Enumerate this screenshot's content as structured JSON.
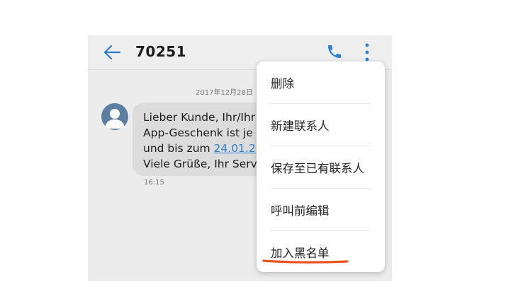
{
  "header": {
    "title": "70251",
    "back_icon": "arrow-left-icon",
    "call_icon": "phone-icon",
    "more_icon": "more-vertical-icon",
    "accent": "#2a7fd2"
  },
  "conversation": {
    "date": "2017年12月28日",
    "message": {
      "line1": "Lieber Kunde, Ihr/Ihr",
      "line2": "App-Geschenk ist je",
      "line3_prefix": "und bis zum ",
      "line3_link": "24.01.2",
      "line4": "Viele Grüße, Ihr Serv"
    },
    "time": "16:15"
  },
  "menu": {
    "items": [
      {
        "label": "删除"
      },
      {
        "label": "新建联系人"
      },
      {
        "label": "保存至已有联系人"
      },
      {
        "label": "呼叫前编辑"
      },
      {
        "label": "加入黑名单"
      }
    ],
    "highlight_color": "#e8521d"
  }
}
